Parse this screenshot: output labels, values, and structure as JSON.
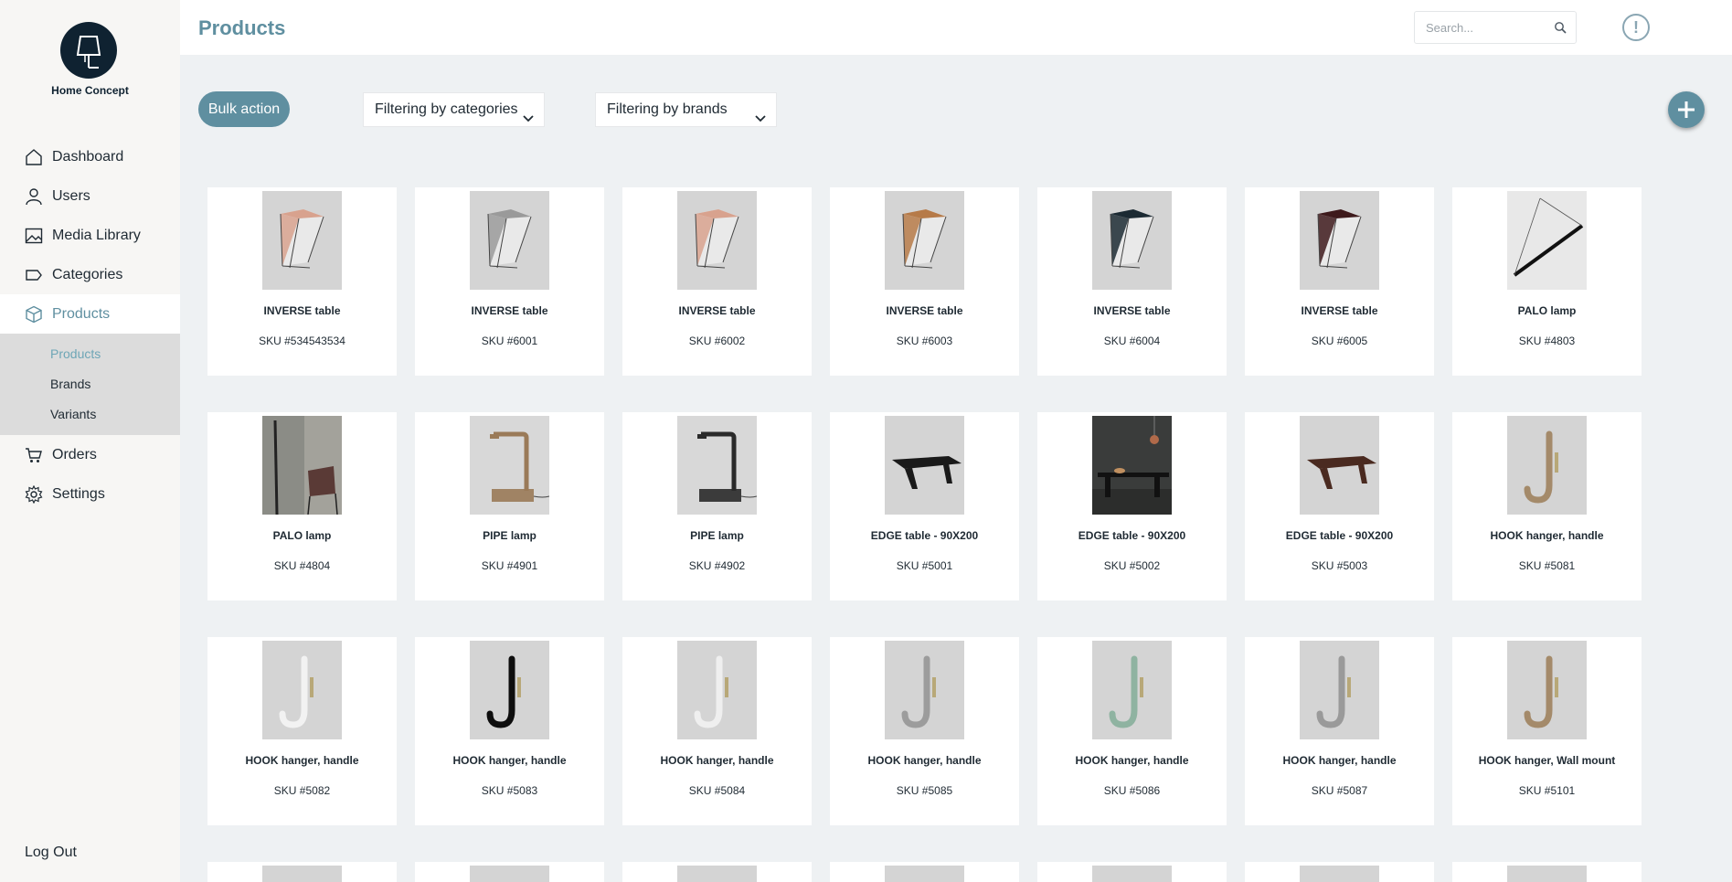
{
  "app": {
    "brand_name": "Home Concept"
  },
  "sidebar": {
    "items": [
      {
        "label": "Dashboard",
        "icon": "home-icon"
      },
      {
        "label": "Users",
        "icon": "user-icon"
      },
      {
        "label": "Media Library",
        "icon": "image-icon"
      },
      {
        "label": "Categories",
        "icon": "tag-icon"
      },
      {
        "label": "Products",
        "icon": "box-icon"
      }
    ],
    "subitems": [
      {
        "label": "Products"
      },
      {
        "label": "Brands"
      },
      {
        "label": "Variants"
      }
    ],
    "items_after": [
      {
        "label": "Orders",
        "icon": "cart-icon"
      },
      {
        "label": "Settings",
        "icon": "gear-icon"
      }
    ],
    "logout_label": "Log Out"
  },
  "header": {
    "title": "Products",
    "search_placeholder": "Search..."
  },
  "toolbar": {
    "bulk_label": "Bulk action",
    "filter_categories": "Filtering by categories",
    "filter_brands": "Filtering by brands"
  },
  "colors": {
    "accent": "#5f8fa0",
    "sidebar_bg": "#f7f6f4",
    "page_bg": "#eef1f3"
  },
  "products": [
    {
      "name": "INVERSE table",
      "sku": "SKU #534543534",
      "kind": "inverse",
      "color": "#d8a28e"
    },
    {
      "name": "INVERSE table",
      "sku": "SKU #6001",
      "kind": "inverse",
      "color": "#9a9a9a"
    },
    {
      "name": "INVERSE table",
      "sku": "SKU #6002",
      "kind": "inverse",
      "color": "#d8a28e"
    },
    {
      "name": "INVERSE table",
      "sku": "SKU #6003",
      "kind": "inverse",
      "color": "#b67a48"
    },
    {
      "name": "INVERSE table",
      "sku": "SKU #6004",
      "kind": "inverse",
      "color": "#1c2a33"
    },
    {
      "name": "INVERSE table",
      "sku": "SKU #6005",
      "kind": "inverse",
      "color": "#3e1a1c"
    },
    {
      "name": "PALO lamp",
      "sku": "SKU #4803",
      "kind": "palo",
      "color": "#111111"
    },
    {
      "name": "PALO lamp",
      "sku": "SKU #4804",
      "kind": "palo-room",
      "color": "#5a3a36"
    },
    {
      "name": "PIPE lamp",
      "sku": "SKU #4901",
      "kind": "pipe",
      "color": "#9a7a58"
    },
    {
      "name": "PIPE lamp",
      "sku": "SKU #4902",
      "kind": "pipe",
      "color": "#2a2a2a"
    },
    {
      "name": "EDGE table - 90X200",
      "sku": "SKU #5001",
      "kind": "edge",
      "color": "#1a1a1a"
    },
    {
      "name": "EDGE table - 90X200",
      "sku": "SKU #5002",
      "kind": "edge-room",
      "color": "#1a1a1a"
    },
    {
      "name": "EDGE table - 90X200",
      "sku": "SKU #5003",
      "kind": "edge",
      "color": "#4a2a20"
    },
    {
      "name": "HOOK hanger, handle",
      "sku": "SKU #5081",
      "kind": "hook",
      "color": "#a48a6a"
    },
    {
      "name": "HOOK hanger, handle",
      "sku": "SKU #5082",
      "kind": "hook",
      "color": "#f2f2f2"
    },
    {
      "name": "HOOK hanger, handle",
      "sku": "SKU #5083",
      "kind": "hook",
      "color": "#0e0e0e"
    },
    {
      "name": "HOOK hanger, handle",
      "sku": "SKU #5084",
      "kind": "hook",
      "color": "#efefef"
    },
    {
      "name": "HOOK hanger, handle",
      "sku": "SKU #5085",
      "kind": "hook",
      "color": "#9c9c9c"
    },
    {
      "name": "HOOK hanger, handle",
      "sku": "SKU #5086",
      "kind": "hook",
      "color": "#8fb3a1"
    },
    {
      "name": "HOOK hanger, handle",
      "sku": "SKU #5087",
      "kind": "hook",
      "color": "#9a9a9a"
    },
    {
      "name": "HOOK hanger, Wall mount",
      "sku": "SKU #5101",
      "kind": "hook",
      "color": "#a48a6a"
    }
  ]
}
